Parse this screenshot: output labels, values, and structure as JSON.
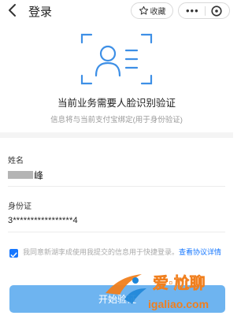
{
  "header": {
    "title": "登录",
    "favorite_label": "收藏",
    "more_icon": "more-dots-icon",
    "close_icon": "close-circle-icon"
  },
  "verify": {
    "icon": "face-id-frame-icon",
    "heading": "当前业务需要人脸识别验证",
    "subheading": "信息将与当前支付宝绑定(用于身份验证)"
  },
  "form": {
    "name_label": "姓名",
    "name_value": "峰",
    "id_label": "身份证",
    "id_value": "3*****************4"
  },
  "agreement": {
    "checked": true,
    "text": "我同意新湖李成使用我提交的信息用于快捷登录。",
    "link": "查看协议详情"
  },
  "start_button": "开始验证",
  "watermark": {
    "brand": "爱·尬聊",
    "url": "igaliao.com"
  },
  "colors": {
    "accent": "#1677ff",
    "button": "#6eb4f0",
    "icon_blue": "#3d8fe6",
    "watermark_orange": "#f07f1e"
  }
}
